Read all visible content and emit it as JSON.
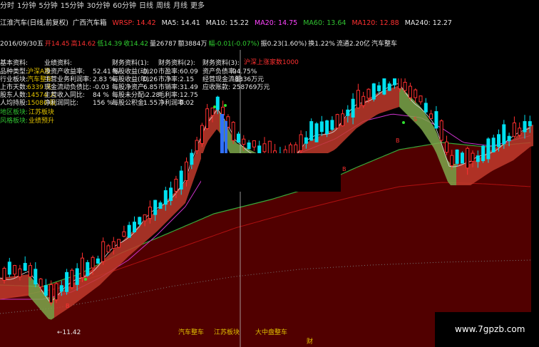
{
  "period_tabs": [
    "分时",
    "1分钟",
    "5分钟",
    "15分钟",
    "30分钟",
    "60分钟",
    "日线",
    "周线",
    "月线",
    "更多"
  ],
  "title": "江淮汽车(日线,前复权)",
  "indicators": [
    {
      "label": "",
      "value": "广西汽车箱",
      "color": "#e8e8e8"
    },
    {
      "label": "",
      "value": "WRSP: 14.42",
      "color": "#ff3030"
    },
    {
      "label": "MA5: ",
      "value": "14.41",
      "color": "#e8e8e8"
    },
    {
      "label": "MA10: ",
      "value": "15.22",
      "color": "#e8e8e8"
    },
    {
      "label": "MA20: ",
      "value": "14.75",
      "color": "#ff44ff"
    },
    {
      "label": "MA60: ",
      "value": "13.64",
      "color": "#30c030"
    },
    {
      "label": "MA120: ",
      "value": "12.88",
      "color": "#ff3030"
    },
    {
      "label": "MA240: ",
      "value": "12.27",
      "color": "#e8e8e8"
    }
  ],
  "quote": [
    {
      "text": "2016/09/30五",
      "color": "#e8e8e8"
    },
    {
      "text": "开14.45",
      "color": "#ff3030"
    },
    {
      "text": "高14.62",
      "color": "#ff3030"
    },
    {
      "text": "低14.39",
      "color": "#30d030"
    },
    {
      "text": "收14.42",
      "color": "#30d030"
    },
    {
      "text": "量26787",
      "color": "#e8e8e8"
    },
    {
      "text": "额3884万",
      "color": "#e8e8e8"
    },
    {
      "text": "幅-0.01(-0.07%)",
      "color": "#30d030"
    },
    {
      "text": "振0.23(1.60%)",
      "color": "#e8e8e8"
    },
    {
      "text": "换1.22%",
      "color": "#e8e8e8"
    },
    {
      "text": "流通2.20亿",
      "color": "#e8e8e8"
    },
    {
      "text": "汽车整车",
      "color": "#e8e8e8"
    }
  ],
  "fin_headers": [
    "基本资料:",
    "业绩资料:",
    "财务资料(1):",
    "财务资料(2):",
    "财务资料(3):"
  ],
  "fin_col1": [
    {
      "k": "品种类型:",
      "v": "沪深A股"
    },
    {
      "k": "行业板块:",
      "v": "汽车整车"
    },
    {
      "k": "上市天数:",
      "v": "6339 天"
    },
    {
      "k": "股东人数:",
      "v": "14574 人"
    },
    {
      "k": "人均持股:",
      "v": "15086 股"
    }
  ],
  "fin_col2": [
    {
      "k": "净资产收益率:",
      "v": "52.41 %"
    },
    {
      "k": "主营业务利润率:",
      "v": "2.83 %"
    },
    {
      "k": "现金流动负债比:",
      "v": "-0.03"
    },
    {
      "k": "主营收入同比:",
      "v": "84 %"
    },
    {
      "k": "净利润同比:",
      "v": "156 %"
    }
  ],
  "fin_col3": [
    {
      "k": "每股收益(动):",
      "v": "0.20"
    },
    {
      "k": "每股收益(年):",
      "v": "0.26"
    },
    {
      "k": "每股净资产:",
      "v": "6.85"
    },
    {
      "k": "每股未分配:",
      "v": "-2.28"
    },
    {
      "k": "每股公积金:",
      "v": "1.55"
    }
  ],
  "fin_col4": [
    {
      "k": "市盈率:",
      "v": "60.09"
    },
    {
      "k": "市净率:",
      "v": "2.15"
    },
    {
      "k": "市销率:",
      "v": "31.49"
    },
    {
      "k": "毛利率:",
      "v": "12.75"
    },
    {
      "k": "净利润率:",
      "v": "0.02"
    }
  ],
  "fin_col5": [
    {
      "k": "资产负债率:",
      "v": "94.75%"
    },
    {
      "k": "经营现金流量:",
      "v": "-8336万元"
    },
    {
      "k": "应收账款:",
      "v": "258769万元"
    }
  ],
  "region_rows": [
    {
      "k": "地区板块:",
      "v": "江苏板块"
    },
    {
      "k": "风格板块:",
      "v": "业绩预升"
    }
  ],
  "annotation_top": "沪深上涨家数1000",
  "price_low_label": "←11.42",
  "bottom_labels": [
    "汽车整车",
    "江苏板块",
    "大中盘整车"
  ],
  "bottom_char": "财",
  "watermark": "www.7gpzb.com",
  "signal_letters": [
    "B",
    "B",
    "S",
    "B"
  ]
}
